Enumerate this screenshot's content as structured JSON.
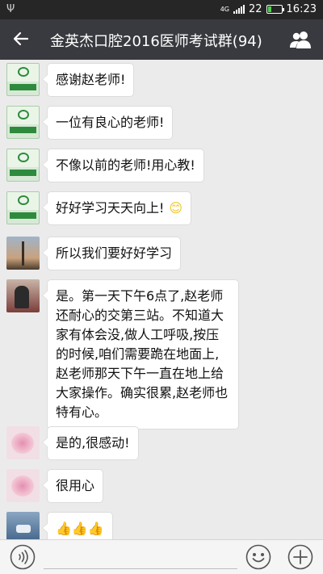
{
  "status_bar": {
    "usb_symbol": "Ψ",
    "network": "4G",
    "battery_level": "22",
    "battery_fraction": 0.22,
    "time": "16:23"
  },
  "header": {
    "title": "金英杰口腔2016医师考试群(94)"
  },
  "messages": [
    {
      "avatar": "green-logo-avatar",
      "text": "感谢赵老师!"
    },
    {
      "avatar": "green-logo-avatar",
      "text": "一位有良心的老师!"
    },
    {
      "avatar": "green-logo-avatar",
      "text": "不像以前的老师!用心教!"
    },
    {
      "avatar": "green-logo-avatar",
      "text": "好好学习天天向上!",
      "emoji": "😊"
    },
    {
      "avatar": "cityscape-avatar",
      "text": "所以我们要好好学习"
    },
    {
      "avatar": "person-red-avatar",
      "text": "是。第一天下午6点了,赵老师还耐心的交第三站。不知道大家有体会没,做人工呼吸,按压的时候,咱们需要跪在地面上,赵老师那天下午一直在地上给大家操作。确实很累,赵老师也特有心。"
    },
    {
      "avatar": "pink-flower-avatar",
      "text": "是的,很感动!"
    },
    {
      "avatar": "pink-flower-avatar",
      "text": "很用心"
    },
    {
      "avatar": "doctor-avatar",
      "text": "👍👍👍"
    }
  ],
  "input_bar": {
    "placeholder": ""
  }
}
